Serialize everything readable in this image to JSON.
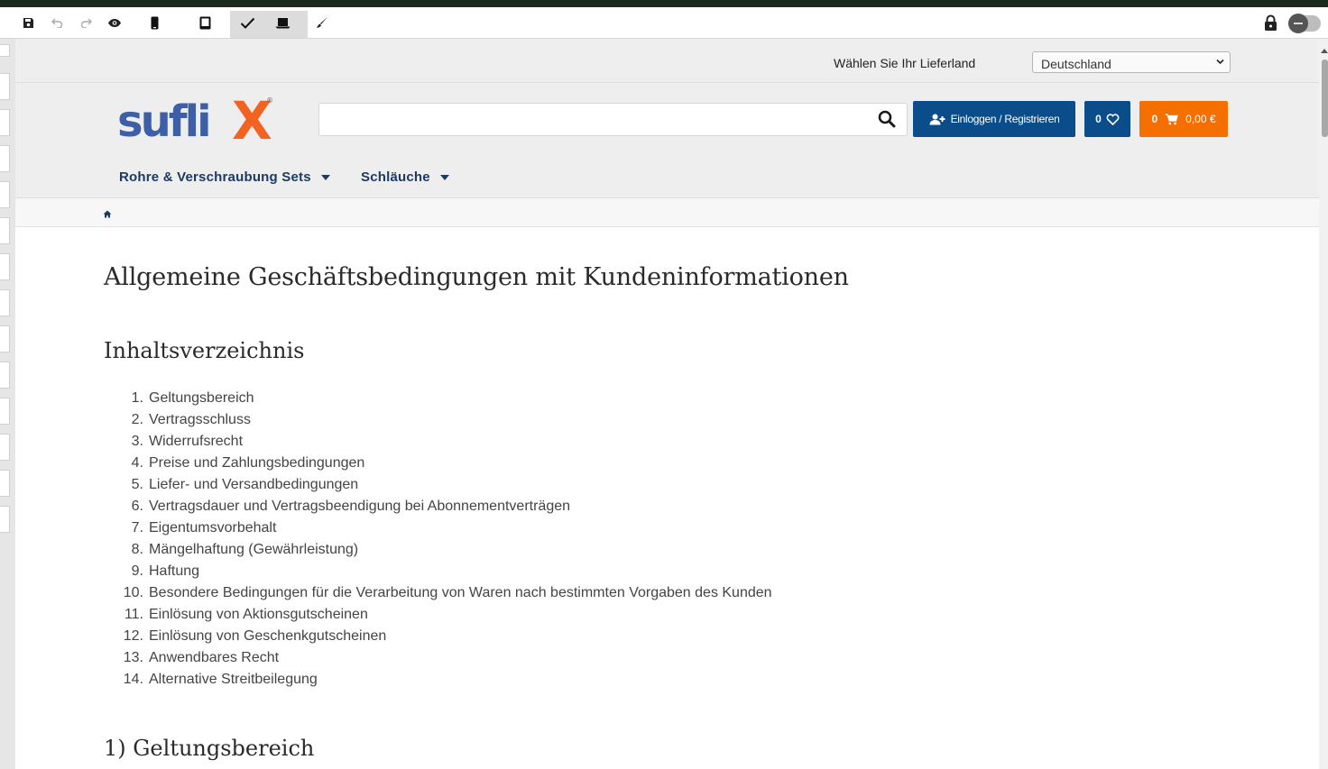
{
  "editor": {
    "toolbar": [
      "save-icon",
      "undo-icon",
      "redo-icon",
      "eye-icon",
      "phone-icon",
      "tablet-icon",
      "check-icon",
      "laptop-icon",
      "brush-icon"
    ],
    "right": [
      "lock-icon",
      "toggle"
    ]
  },
  "country": {
    "label": "Wählen Sie Ihr Lieferland",
    "selected": "Deutschland"
  },
  "header": {
    "logo_text": "sufli",
    "logo_accent": "X",
    "logo_mark": "®",
    "search_value": "",
    "login_label": "Einloggen / Registrieren",
    "wishlist_count": "0",
    "cart_count": "0",
    "cart_total": "0,00 €"
  },
  "nav": {
    "items": [
      "Rohre & Verschraubung Sets",
      "Schläuche"
    ]
  },
  "colors": {
    "brand_blue": "#0b4c8a",
    "brand_orange": "#f56e00",
    "logo_blue": "#3d5fa8",
    "logo_orange": "#f26322",
    "nav_text": "#1d3a64"
  },
  "main": {
    "title": "Allgemeine Geschäftsbedingungen mit Kundeninformationen",
    "toc_title": "Inhaltsverzeichnis",
    "toc": [
      {
        "num": "1.",
        "label": "Geltungsbereich"
      },
      {
        "num": "2.",
        "label": "Vertragsschluss"
      },
      {
        "num": "3.",
        "label": "Widerrufsrecht"
      },
      {
        "num": "4.",
        "label": "Preise und Zahlungsbedingungen"
      },
      {
        "num": "5.",
        "label": "Liefer- und Versandbedingungen"
      },
      {
        "num": "6.",
        "label": "Vertragsdauer und Vertragsbeendigung bei Abonnementverträgen"
      },
      {
        "num": "7.",
        "label": "Eigentumsvorbehalt"
      },
      {
        "num": "8.",
        "label": "Mängelhaftung (Gewährleistung)"
      },
      {
        "num": "9.",
        "label": "Haftung"
      },
      {
        "num": "10.",
        "label": "Besondere Bedingungen für die Verarbeitung von Waren nach bestimmten Vorgaben des Kunden"
      },
      {
        "num": "11.",
        "label": "Einlösung von Aktionsgutscheinen"
      },
      {
        "num": "12.",
        "label": "Einlösung von Geschenkgutscheinen"
      },
      {
        "num": "13.",
        "label": "Anwendbares Recht"
      },
      {
        "num": "14.",
        "label": "Alternative Streitbeilegung"
      }
    ],
    "section_1_title": "1) Geltungsbereich"
  }
}
